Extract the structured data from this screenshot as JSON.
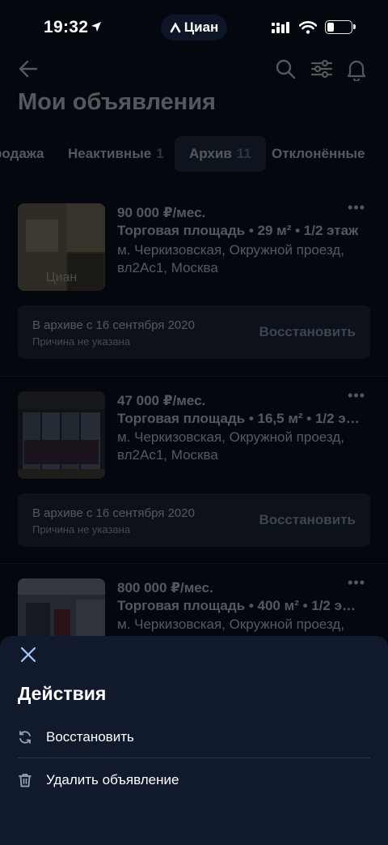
{
  "status_bar": {
    "time": "19:32",
    "carrier_app": "Циан",
    "battery_level": 0.3
  },
  "header": {
    "title": "Мои объявления"
  },
  "tabs": [
    {
      "label": "родажа",
      "count": ""
    },
    {
      "label": "Неактивные",
      "count": "1"
    },
    {
      "label": "Архив",
      "count": "11",
      "active": true
    },
    {
      "label": "Отклонённые",
      "count": ""
    }
  ],
  "listings": [
    {
      "price": "90 000 ₽/мес.",
      "meta": "Торговая площадь • 29 м² • 1/2 этаж",
      "address": "м. Черкизовская, Окружной проезд, вл2Ас1, Москва",
      "archived_since": "В архиве с 16 сентября 2020",
      "reason": "Причина не указана",
      "restore_label": "Восстановить",
      "watermark": "Циан"
    },
    {
      "price": "47 000 ₽/мес.",
      "meta": "Торговая площадь • 16,5 м² • 1/2 э…",
      "address": "м. Черкизовская, Окружной проезд, вл2Ас1, Москва",
      "archived_since": "В архиве с 16 сентября 2020",
      "reason": "Причина не указана",
      "restore_label": "Восстановить"
    },
    {
      "price": "800 000 ₽/мес.",
      "meta": "Торговая площадь • 400 м² • 1/2 э…",
      "address": "м. Черкизовская, Окружной проезд,"
    }
  ],
  "sheet": {
    "title": "Действия",
    "actions": [
      {
        "label": "Восстановить",
        "icon": "refresh-icon"
      },
      {
        "label": "Удалить объявление",
        "icon": "trash-icon"
      }
    ]
  },
  "colors": {
    "background": "#04070d",
    "sheet": "#111a2c",
    "archive_box": "#1d2636",
    "restore_text": "#b9c8e0"
  }
}
